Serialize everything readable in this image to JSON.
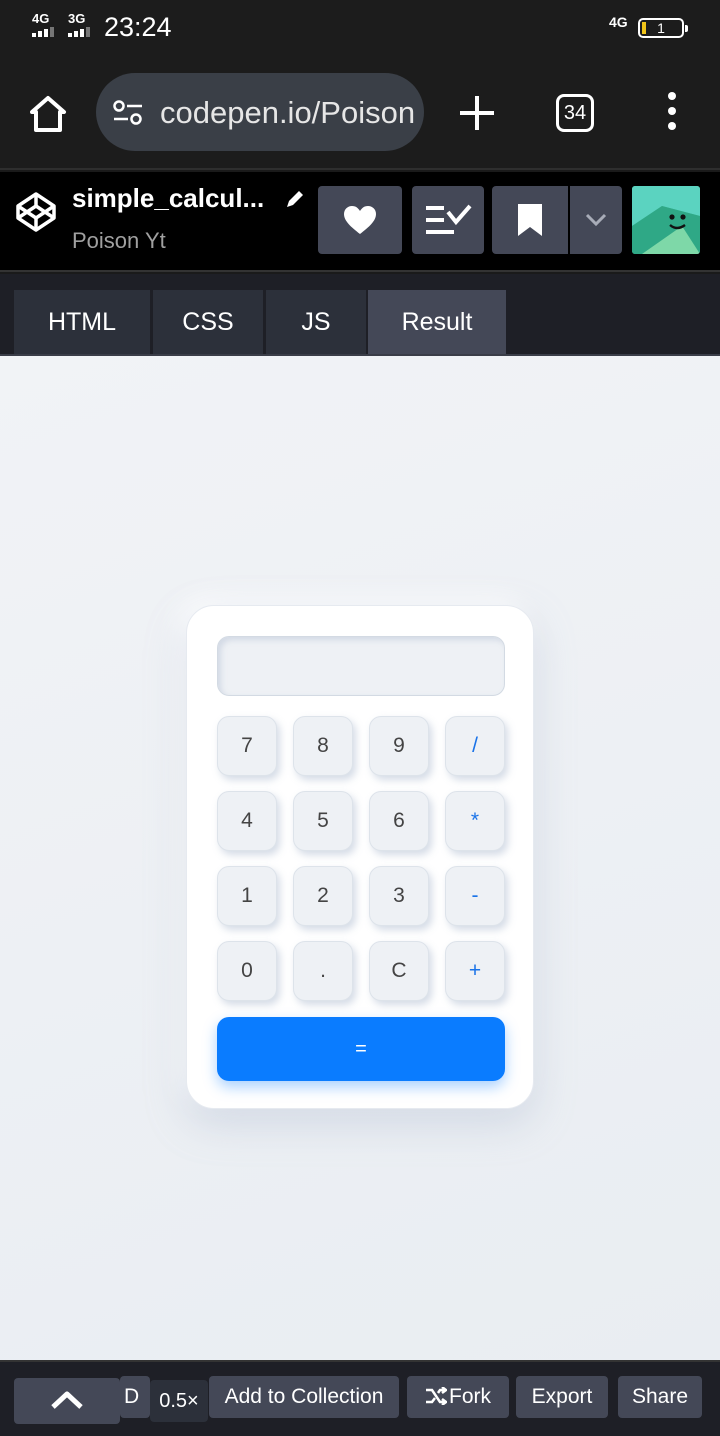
{
  "status_bar": {
    "network_left_1": "4G",
    "network_left_2": "3G",
    "time": "23:24",
    "network_right": "4G",
    "battery": "1"
  },
  "browser": {
    "url": "codepen.io/Poison",
    "tab_count": "34"
  },
  "pen": {
    "title": "simple_calcul...",
    "author": "Poison Yt"
  },
  "editor_tabs": [
    {
      "label": "HTML"
    },
    {
      "label": "CSS"
    },
    {
      "label": "JS"
    },
    {
      "label": "Result"
    }
  ],
  "calculator": {
    "display_value": "",
    "keys": [
      {
        "label": "7",
        "type": "digit"
      },
      {
        "label": "8",
        "type": "digit"
      },
      {
        "label": "9",
        "type": "digit"
      },
      {
        "label": "/",
        "type": "operator"
      },
      {
        "label": "4",
        "type": "digit"
      },
      {
        "label": "5",
        "type": "digit"
      },
      {
        "label": "6",
        "type": "digit"
      },
      {
        "label": "*",
        "type": "operator"
      },
      {
        "label": "1",
        "type": "digit"
      },
      {
        "label": "2",
        "type": "digit"
      },
      {
        "label": "3",
        "type": "digit"
      },
      {
        "label": "-",
        "type": "operator"
      },
      {
        "label": "0",
        "type": "digit"
      },
      {
        "label": ".",
        "type": "digit"
      },
      {
        "label": "C",
        "type": "digit"
      },
      {
        "label": "+",
        "type": "operator"
      }
    ],
    "equals_label": "=",
    "accent_color": "#0a7cff"
  },
  "bottom_bar": {
    "details_label": "D",
    "zoom_label": "0.5×",
    "add_to_collection_label": "Add to Collection",
    "fork_label": "Fork",
    "export_label": "Export",
    "share_label": "Share"
  }
}
